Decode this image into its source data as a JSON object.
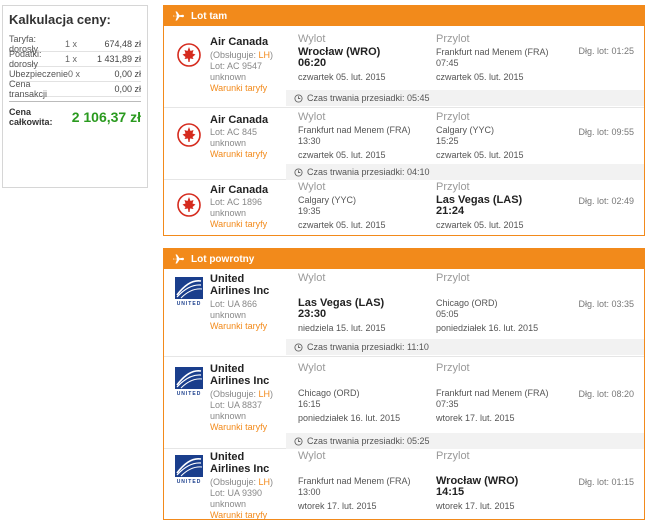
{
  "price": {
    "title": "Kalkulacja ceny:",
    "rows": [
      {
        "label": "Taryfa: dorosły",
        "mult": "1 x",
        "value": "674,48 zł"
      },
      {
        "label": "Podatki: dorosły",
        "mult": "1 x",
        "value": "1 431,89 zł"
      },
      {
        "label": "Ubezpieczenie",
        "mult": "0 x",
        "value": "0,00 zł"
      },
      {
        "label": "Cena transakcji",
        "mult": "",
        "value": "0,00 zł"
      }
    ],
    "total_label": "Cena całkowita:",
    "total_value": "2 106,37 zł"
  },
  "outbound": {
    "title": "Lot tam",
    "segments": [
      {
        "airline": "Air Canada",
        "operated_prefix": "(Obsługuje: ",
        "operated_code": "LH",
        "operated_suffix": ")",
        "flight": "Lot: AC 9547",
        "status": "unknown",
        "tariff": "Warunki taryfy",
        "dep_hdr": "Wylot",
        "dep_city": "Wrocław (WRO)",
        "dep_time": "06:20",
        "dep_date": "czwartek 05. lut. 2015",
        "arr_hdr": "Przylot",
        "arr_city": "Frankfurt nad Menem (FRA)",
        "arr_time": "07:45",
        "arr_date": "czwartek 05. lut. 2015",
        "duration": "Dłg. lot: 01:25",
        "layover": "Czas trwania przesiadki: 05:45"
      },
      {
        "airline": "Air Canada",
        "flight": "Lot: AC 845",
        "status": "unknown",
        "tariff": "Warunki taryfy",
        "dep_hdr": "Wylot",
        "dep_city": "Frankfurt nad Menem (FRA)",
        "dep_time": "13:30",
        "dep_date": "czwartek 05. lut. 2015",
        "arr_hdr": "Przylot",
        "arr_city": "Calgary (YYC)",
        "arr_time": "15:25",
        "arr_date": "czwartek 05. lut. 2015",
        "duration": "Dłg. lot: 09:55",
        "layover": "Czas trwania przesiadki: 04:10"
      },
      {
        "airline": "Air Canada",
        "flight": "Lot: AC 1896",
        "status": "unknown",
        "tariff": "Warunki taryfy",
        "dep_hdr": "Wylot",
        "dep_city": "Calgary (YYC)",
        "dep_time": "19:35",
        "dep_date": "czwartek 05. lut. 2015",
        "arr_hdr": "Przylot",
        "arr_city": "Las Vegas (LAS)",
        "arr_time": "21:24",
        "arr_date": "czwartek 05. lut. 2015",
        "duration": "Dłg. lot: 02:49"
      }
    ]
  },
  "inbound": {
    "title": "Lot powrotny",
    "segments": [
      {
        "airline": "United Airlines Inc",
        "logo_text": "UNITED",
        "flight": "Lot: UA 866",
        "status": "unknown",
        "tariff": "Warunki taryfy",
        "dep_hdr": "Wylot",
        "dep_city": "Las Vegas (LAS)",
        "dep_time": "23:30",
        "dep_date": "niedziela 15. lut. 2015",
        "arr_hdr": "Przylot",
        "arr_city": "Chicago (ORD)",
        "arr_time": "05:05",
        "arr_date": "poniedziałek 16. lut. 2015",
        "duration": "Dłg. lot: 03:35",
        "layover": "Czas trwania przesiadki: 11:10"
      },
      {
        "airline": "United Airlines Inc",
        "logo_text": "UNITED",
        "operated_prefix": "(Obsługuje: ",
        "operated_code": "LH",
        "operated_suffix": ")",
        "flight": "Lot: UA 8837",
        "status": "unknown",
        "tariff": "Warunki taryfy",
        "dep_hdr": "Wylot",
        "dep_city": "Chicago (ORD)",
        "dep_time": "16:15",
        "dep_date": "poniedziałek 16. lut. 2015",
        "arr_hdr": "Przylot",
        "arr_city": "Frankfurt nad Menem (FRA)",
        "arr_time": "07:35",
        "arr_date": "wtorek 17. lut. 2015",
        "duration": "Dłg. lot: 08:20",
        "layover": "Czas trwania przesiadki: 05:25"
      },
      {
        "airline": "United Airlines Inc",
        "logo_text": "UNITED",
        "operated_prefix": "(Obsługuje: ",
        "operated_code": "LH",
        "operated_suffix": ")",
        "flight": "Lot: UA 9390",
        "status": "unknown",
        "tariff": "Warunki taryfy",
        "dep_hdr": "Wylot",
        "dep_city": "Frankfurt nad Menem (FRA)",
        "dep_time": "13:00",
        "dep_date": "wtorek 17. lut. 2015",
        "arr_hdr": "Przylot",
        "arr_city": "Wrocław (WRO)",
        "arr_time": "14:15",
        "arr_date": "wtorek 17. lut. 2015",
        "duration": "Dłg. lot: 01:15"
      }
    ]
  },
  "colors": {
    "accent": "#f28a1b",
    "total": "#2a9a1f",
    "air_canada": "#d52b1e",
    "united": "#1a3e8c"
  }
}
